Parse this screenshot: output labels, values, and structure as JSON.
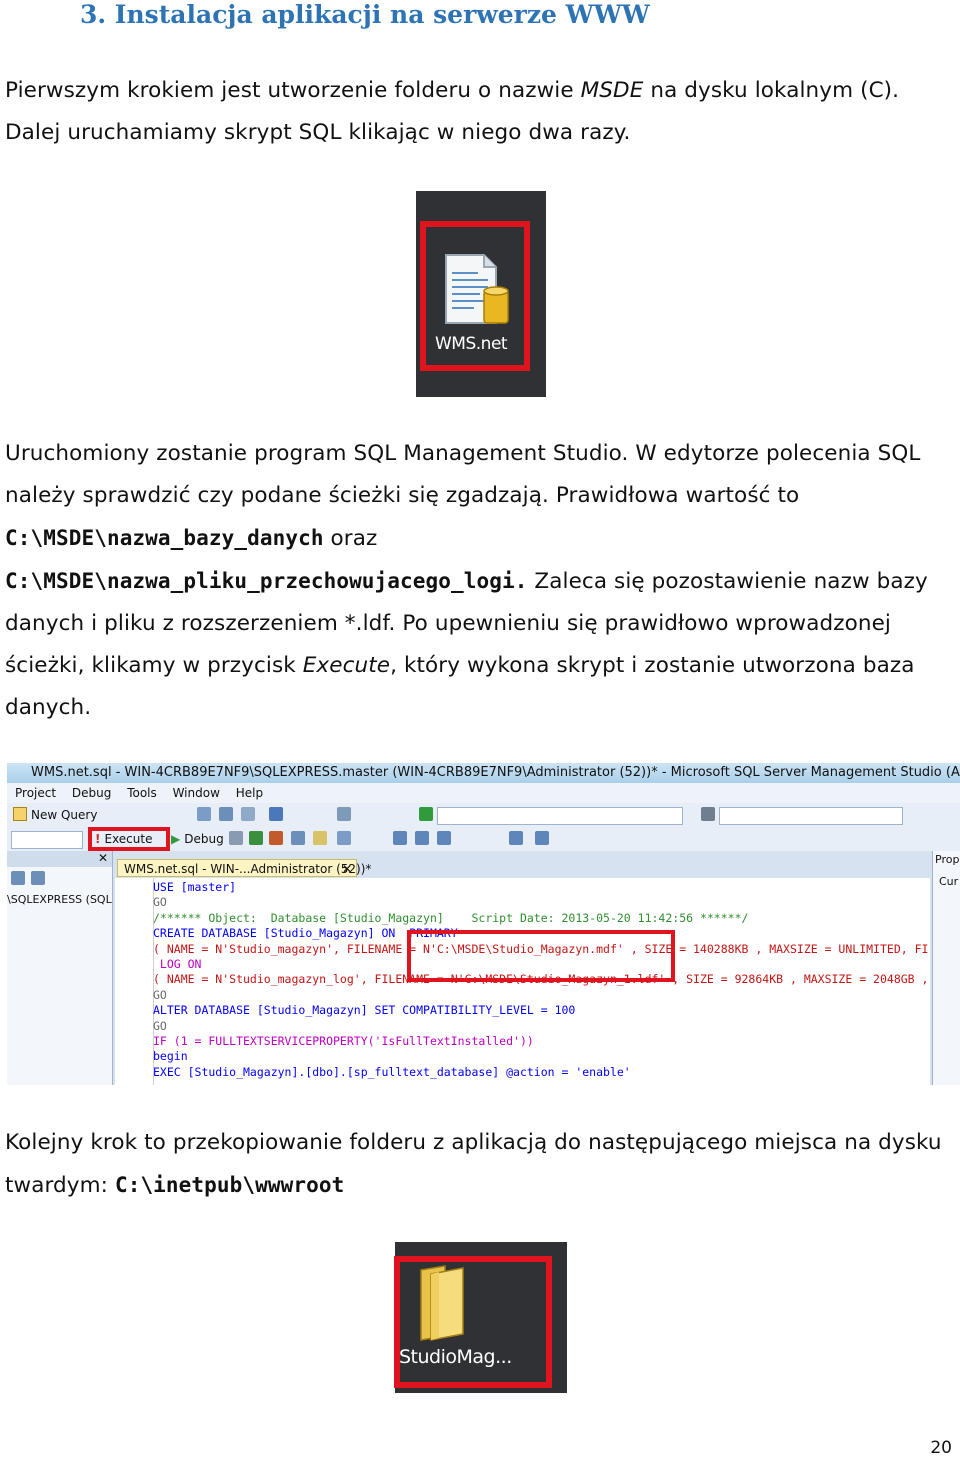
{
  "heading": "3. Instalacja aplikacji na serwerze WWW",
  "para1": {
    "a": "Pierwszym krokiem jest utworzenie folderu o nazwie ",
    "b": "MSDE",
    "c": " na dysku lokalnym (C). Dalej uruchamiamy skrypt SQL klikając w niego dwa razy."
  },
  "icon1": {
    "label": "WMS.net",
    "icon": "sql-script-file-icon"
  },
  "para2": {
    "a": "Uruchomiony zostanie program SQL Management Studio. W edytorze polecenia SQL należy sprawdzić czy podane ścieżki się zgadzają. Prawidłowa wartość to ",
    "b": "C:\\MSDE\\nazwa_bazy_danych",
    "c": " oraz ",
    "d": "C:\\MSDE\\nazwa_pliku_przechowujacego_logi.",
    "e": " Zaleca się pozostawienie nazw bazy danych i pliku z rozszerzeniem *.ldf. Po upewnieniu się prawidłowo wprowadzonej ścieżki, klikamy w przycisk ",
    "f": "Execute",
    "g": ", który wykona skrypt i zostanie utworzona baza danych."
  },
  "ssms": {
    "title": "WMS.net.sql - WIN-4CRB89E7NF9\\SQLEXPRESS.master (WIN-4CRB89E7NF9\\Administrator (52))* - Microsoft SQL Server Management Studio (Admin",
    "menu": [
      "Project",
      "Debug",
      "Tools",
      "Window",
      "Help"
    ],
    "new_query": "New Query",
    "execute": "Execute",
    "debug": "Debug",
    "server_label": "\\SQLEXPRESS (SQL S",
    "tab": "WMS.net.sql - WIN-...Administrator (52))*",
    "right_top": "Prop",
    "right_sub": "Cur",
    "code": [
      "USE [master]",
      "GO",
      "/****** Object:  Database [Studio_Magazyn]    Script Date: 2013-05-20 11:42:56 ******/",
      "CREATE DATABASE [Studio_Magazyn] ON  PRIMARY",
      "( NAME = N'Studio_magazyn', FILENAME = N'C:\\MSDE\\Studio_Magazyn.mdf' , SIZE = 140288KB , MAXSIZE = UNLIMITED, FI",
      " LOG ON",
      "( NAME = N'Studio_magazyn_log', FILENAME = N'C:\\MSDE\\Studio_Magazyn_1.ldf' , SIZE = 92864KB , MAXSIZE = 2048GB ,",
      "GO",
      "ALTER DATABASE [Studio_Magazyn] SET COMPATIBILITY_LEVEL = 100",
      "GO",
      "IF (1 = FULLTEXTSERVICEPROPERTY('IsFullTextInstalled'))",
      "begin",
      "EXEC [Studio_Magazyn].[dbo].[sp_fulltext_database] @action = 'enable'"
    ]
  },
  "para3": {
    "a": "Kolejny krok to przekopiowanie folderu z aplikacją do następującego miejsca na dysku twardym: ",
    "b": "C:\\inetpub\\wwwroot"
  },
  "icon2": {
    "label": "StudioMag...",
    "icon": "folder-icon"
  },
  "page_number": "20"
}
